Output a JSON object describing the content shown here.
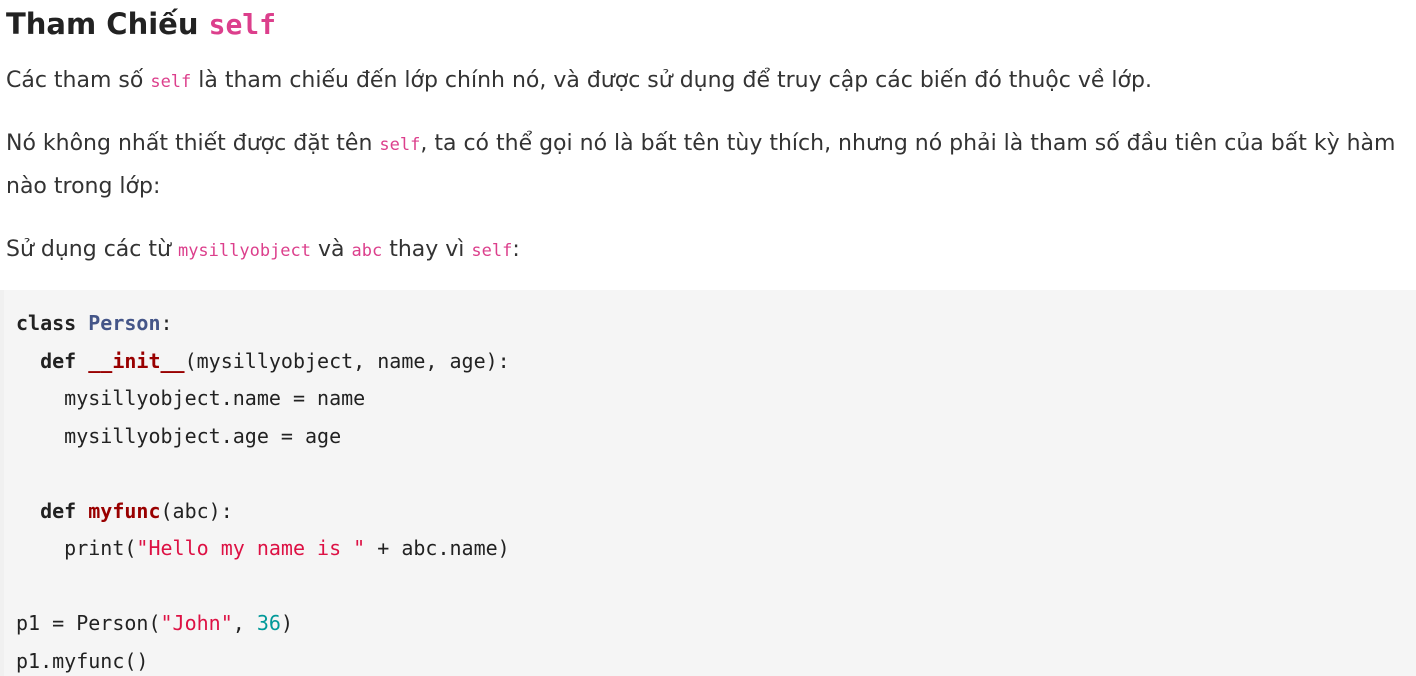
{
  "heading": {
    "text": "Tham Chiếu ",
    "code": "self"
  },
  "paragraphs": {
    "p1": {
      "before": "Các tham số ",
      "code": "self",
      "after": " là tham chiếu đến lớp chính nó, và được sử dụng để truy cập các biến đó thuộc về lớp."
    },
    "p2": {
      "before": "Nó không nhất thiết được đặt tên ",
      "code": "self",
      "after": ", ta có thể gọi nó là bất tên tùy thích, nhưng nó phải là tham số đầu tiên của bất kỳ hàm nào trong lớp:"
    },
    "p3": {
      "part1": "Sử dụng các từ ",
      "code1": "mysillyobject",
      "part2": " và ",
      "code2": "abc",
      "part3": " thay vì ",
      "code3": "self",
      "part4": ":"
    }
  },
  "code": {
    "l1": {
      "kw": "class",
      "sp": " ",
      "name": "Person",
      "rest": ":"
    },
    "l2": {
      "indent": "  ",
      "kw": "def",
      "sp": " ",
      "name": "__init__",
      "rest": "(mysillyobject, name, age):"
    },
    "l3": {
      "text": "    mysillyobject.name = name"
    },
    "l4": {
      "text": "    mysillyobject.age = age"
    },
    "l6": {
      "indent": "  ",
      "kw": "def",
      "sp": " ",
      "name": "myfunc",
      "rest": "(abc):"
    },
    "l7": {
      "pre": "    print(",
      "str": "\"Hello my name is \"",
      "post": " + abc.name)"
    },
    "l9": {
      "pre": "p1 = Person(",
      "str": "\"John\"",
      "mid": ", ",
      "num": "36",
      "post": ")"
    },
    "l10": {
      "text": "p1.myfunc()"
    }
  }
}
